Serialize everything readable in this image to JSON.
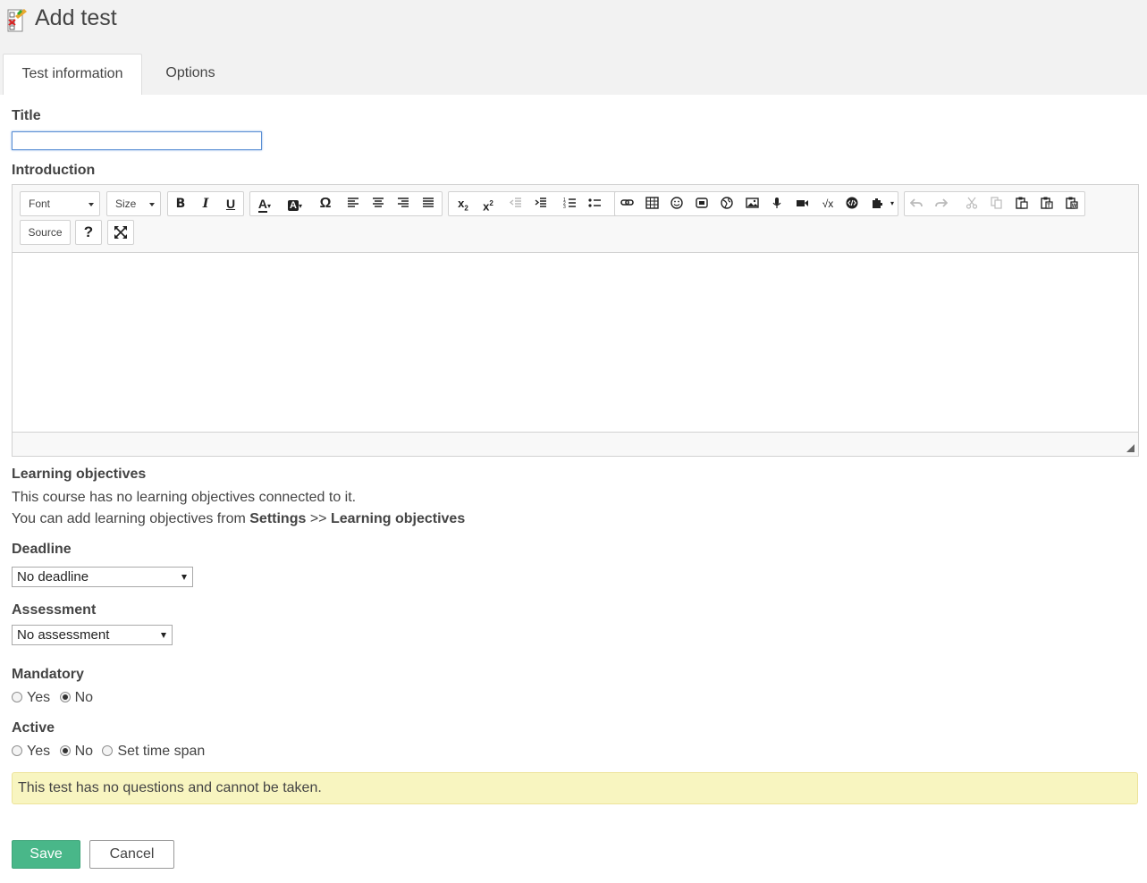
{
  "header": {
    "title": "Add test",
    "icon": "test-add-icon",
    "tabs": [
      {
        "label": "Test information",
        "active": true
      },
      {
        "label": "Options",
        "active": false
      }
    ]
  },
  "form": {
    "title_label": "Title",
    "title_value": "",
    "introduction_label": "Introduction",
    "editor": {
      "font_combo": "Font",
      "size_combo": "Size",
      "source_label": "Source",
      "help_label": "?",
      "buttons": [
        "bold-icon",
        "italic-icon",
        "underline-icon",
        "text-color-icon",
        "background-color-icon",
        "special-char-icon",
        "align-left-icon",
        "align-center-icon",
        "align-right-icon",
        "align-justify-icon",
        "subscript-icon",
        "superscript-icon",
        "outdent-icon",
        "indent-icon",
        "numbered-list-icon",
        "bullet-list-icon",
        "link-icon",
        "table-icon",
        "smiley-icon",
        "flash-icon",
        "globe-icon",
        "image-icon",
        "audio-icon",
        "video-icon",
        "math-icon",
        "embed-code-icon",
        "plugin-icon",
        "undo-icon",
        "redo-icon",
        "cut-icon",
        "copy-icon",
        "paste-icon",
        "paste-text-icon",
        "paste-word-icon",
        "maximize-icon"
      ]
    },
    "learning_objectives": {
      "label": "Learning objectives",
      "line1": "This course has no learning objectives connected to it.",
      "line2_prefix": "You can add learning objectives from ",
      "line2_settings": "Settings",
      "line2_sep": " >> ",
      "line2_target": "Learning objectives"
    },
    "deadline": {
      "label": "Deadline",
      "value": "No deadline"
    },
    "assessment": {
      "label": "Assessment",
      "value": "No assessment"
    },
    "mandatory": {
      "label": "Mandatory",
      "options": [
        "Yes",
        "No"
      ],
      "selected": "No"
    },
    "active": {
      "label": "Active",
      "options": [
        "Yes",
        "No",
        "Set time span"
      ],
      "selected": "No"
    },
    "alert": "This test has no questions and cannot be taken.",
    "save_label": "Save",
    "cancel_label": "Cancel"
  },
  "colors": {
    "save": "#49b789",
    "alert_bg": "#f8f5c0",
    "focus": "#5b8fd4"
  }
}
